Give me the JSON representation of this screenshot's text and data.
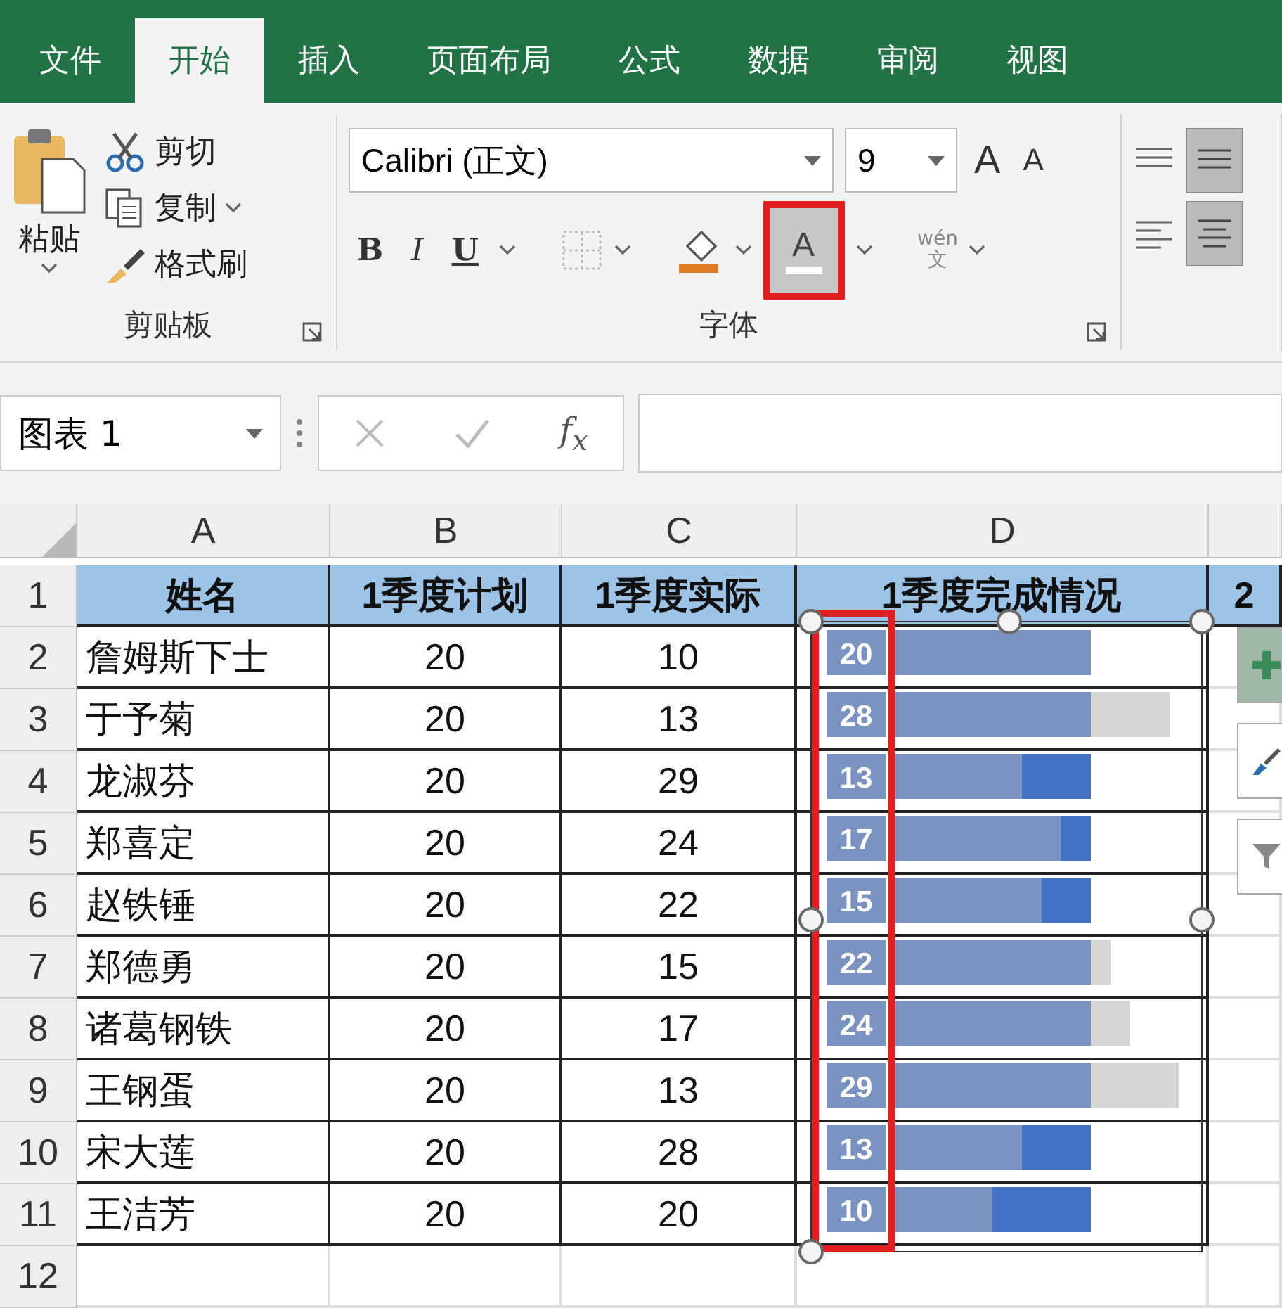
{
  "ribbon_tabs": [
    {
      "label": "文件",
      "selected": false
    },
    {
      "label": "开始",
      "selected": true
    },
    {
      "label": "插入",
      "selected": false
    },
    {
      "label": "页面布局",
      "selected": false
    },
    {
      "label": "公式",
      "selected": false
    },
    {
      "label": "数据",
      "selected": false
    },
    {
      "label": "审阅",
      "selected": false
    },
    {
      "label": "视图",
      "selected": false
    }
  ],
  "clipboard": {
    "paste": "粘贴",
    "cut": "剪切",
    "copy": "复制",
    "format_painter": "格式刷",
    "group_label": "剪贴板"
  },
  "font": {
    "font_name": "Calibri (正文)",
    "font_size": "9",
    "grow": "A",
    "shrink": "A",
    "bold": "B",
    "italic": "I",
    "underline": "U",
    "font_color": "A",
    "phonetic_top": "wén",
    "phonetic_bottom": "文",
    "group_label": "字体"
  },
  "formula_bar": {
    "name_box": "图表 1",
    "function_label": "f$_{x}$"
  },
  "columns": [
    "A",
    "B",
    "C",
    "D"
  ],
  "header_row": {
    "number": "1",
    "cells": [
      "姓名",
      "1季度计划",
      "1季度实际",
      "1季度完成情况",
      "2"
    ]
  },
  "rows": [
    {
      "number": "2",
      "name": "詹姆斯下士",
      "plan": "20",
      "actual": "10"
    },
    {
      "number": "3",
      "name": "于予菊",
      "plan": "20",
      "actual": "13"
    },
    {
      "number": "4",
      "name": "龙淑芬",
      "plan": "20",
      "actual": "29"
    },
    {
      "number": "5",
      "name": "郑喜定",
      "plan": "20",
      "actual": "24"
    },
    {
      "number": "6",
      "name": "赵铁锤",
      "plan": "20",
      "actual": "22"
    },
    {
      "number": "7",
      "name": "郑德勇",
      "plan": "20",
      "actual": "15"
    },
    {
      "number": "8",
      "name": "诸葛钢铁",
      "plan": "20",
      "actual": "17"
    },
    {
      "number": "9",
      "name": "王钢蛋",
      "plan": "20",
      "actual": "13"
    },
    {
      "number": "10",
      "name": "宋大莲",
      "plan": "20",
      "actual": "28"
    },
    {
      "number": "11",
      "name": "王洁芳",
      "plan": "20",
      "actual": "20"
    }
  ],
  "empty_rows": [
    "12"
  ],
  "chart": {
    "data_labels": [
      "20",
      "28",
      "13",
      "17",
      "15",
      "22",
      "24",
      "29",
      "13",
      "10"
    ]
  }
}
